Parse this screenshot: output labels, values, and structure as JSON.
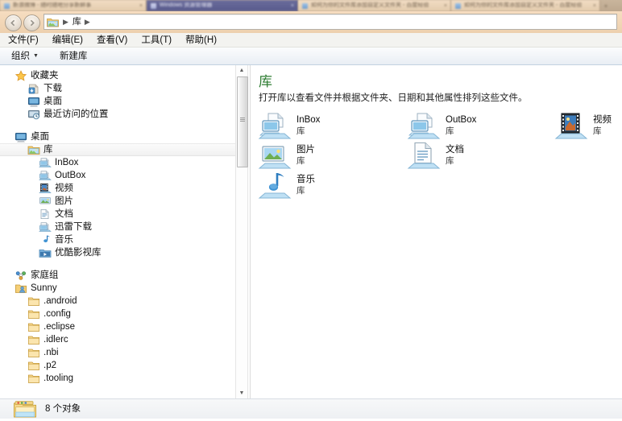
{
  "browser_tabs": {
    "tabs": [
      {
        "title": "新浪微博 - 随时随地分享新鲜事",
        "active": false,
        "close": "×"
      },
      {
        "title": "Windows 资源管理器",
        "active": true,
        "close": "×"
      },
      {
        "title": "如何为你的文件库添加自定义文件夹 - 百度经验",
        "active": false,
        "close": "×"
      },
      {
        "title": "如何为你的文件库添加自定义文件夹 - 百度经验",
        "active": false,
        "close": "×"
      }
    ],
    "new_tab_label": "+"
  },
  "nav": {
    "back_icon": "back-arrow-icon",
    "forward_icon": "forward-arrow-icon",
    "history_caret": "▼",
    "address_icon": "libraries-folder-icon",
    "breadcrumbs": [
      "库"
    ],
    "separator": "▶"
  },
  "menubar": {
    "items": [
      {
        "label": "文件(F)"
      },
      {
        "label": "编辑(E)"
      },
      {
        "label": "查看(V)"
      },
      {
        "label": "工具(T)"
      },
      {
        "label": "帮助(H)"
      }
    ]
  },
  "toolbar": {
    "organize_label": "组织",
    "organize_caret": "▼",
    "new_library_label": "新建库"
  },
  "sidebar": {
    "groups": [
      {
        "root": {
          "label": "收藏夹",
          "icon": "star-icon",
          "level": 0
        },
        "children": [
          {
            "label": "下载",
            "icon": "downloads-icon",
            "level": 1
          },
          {
            "label": "桌面",
            "icon": "desktop-icon",
            "level": 1
          },
          {
            "label": "最近访问的位置",
            "icon": "recent-places-icon",
            "level": 1
          }
        ]
      },
      {
        "root": {
          "label": "桌面",
          "icon": "desktop-icon",
          "level": 0
        },
        "children": []
      },
      {
        "root": {
          "label": "库",
          "icon": "library-folder-icon",
          "level": 1,
          "selected": true
        },
        "children": [
          {
            "label": "InBox",
            "icon": "library-screen-icon",
            "level": 2
          },
          {
            "label": "OutBox",
            "icon": "library-screen-icon",
            "level": 2
          },
          {
            "label": "视频",
            "icon": "video-library-icon",
            "level": 2
          },
          {
            "label": "图片",
            "icon": "pictures-library-icon",
            "level": 2
          },
          {
            "label": "文档",
            "icon": "documents-library-icon",
            "level": 2
          },
          {
            "label": "迅雷下载",
            "icon": "library-screen-icon",
            "level": 2
          },
          {
            "label": "音乐",
            "icon": "music-library-icon",
            "level": 2
          },
          {
            "label": "优酷影视库",
            "icon": "video-folder-icon",
            "level": 2
          }
        ]
      },
      {
        "root": {
          "label": "家庭组",
          "icon": "homegroup-icon",
          "level": 0
        },
        "children": []
      },
      {
        "root": {
          "label": "Sunny",
          "icon": "user-folder-icon",
          "level": 0
        },
        "children": [
          {
            "label": ".android",
            "icon": "folder-icon",
            "level": 1
          },
          {
            "label": ".config",
            "icon": "folder-icon",
            "level": 1
          },
          {
            "label": ".eclipse",
            "icon": "folder-icon",
            "level": 1
          },
          {
            "label": ".idlerc",
            "icon": "folder-icon",
            "level": 1
          },
          {
            "label": ".nbi",
            "icon": "folder-icon",
            "level": 1
          },
          {
            "label": ".p2",
            "icon": "folder-icon",
            "level": 1
          },
          {
            "label": ".tooling",
            "icon": "folder-icon",
            "level": 1
          }
        ]
      }
    ],
    "scrollbar": {
      "up_arrow": "▲",
      "down_arrow": "▼"
    }
  },
  "content": {
    "title": "库",
    "subtitle": "打开库以查看文件并根据文件夹、日期和其他属性排列这些文件。",
    "type_label": "库",
    "items": [
      {
        "name": "InBox",
        "type": "库",
        "icon": "library-screen-icon",
        "col": 0,
        "row": 0
      },
      {
        "name": "OutBox",
        "type": "库",
        "icon": "library-screen-icon",
        "col": 1,
        "row": 0
      },
      {
        "name": "视频",
        "type": "库",
        "icon": "video-library-icon",
        "col": 2,
        "row": 0
      },
      {
        "name": "图片",
        "type": "库",
        "icon": "pictures-library-icon",
        "col": 0,
        "row": 1
      },
      {
        "name": "文档",
        "type": "库",
        "icon": "documents-library-icon",
        "col": 1,
        "row": 1
      },
      {
        "name": "音乐",
        "type": "库",
        "icon": "music-library-icon",
        "col": 0,
        "row": 2
      }
    ]
  },
  "statusbar": {
    "icon": "library-folder-icon",
    "text": "8 个对象"
  },
  "colors": {
    "title_green": "#2e7d32",
    "tab_active": "#585a8c",
    "tab_inactive": "#e8d0b2",
    "address_bar_bg": "#ffffff",
    "toolbar_bg": "#eef2f7",
    "selection": "#f3f3f3"
  }
}
